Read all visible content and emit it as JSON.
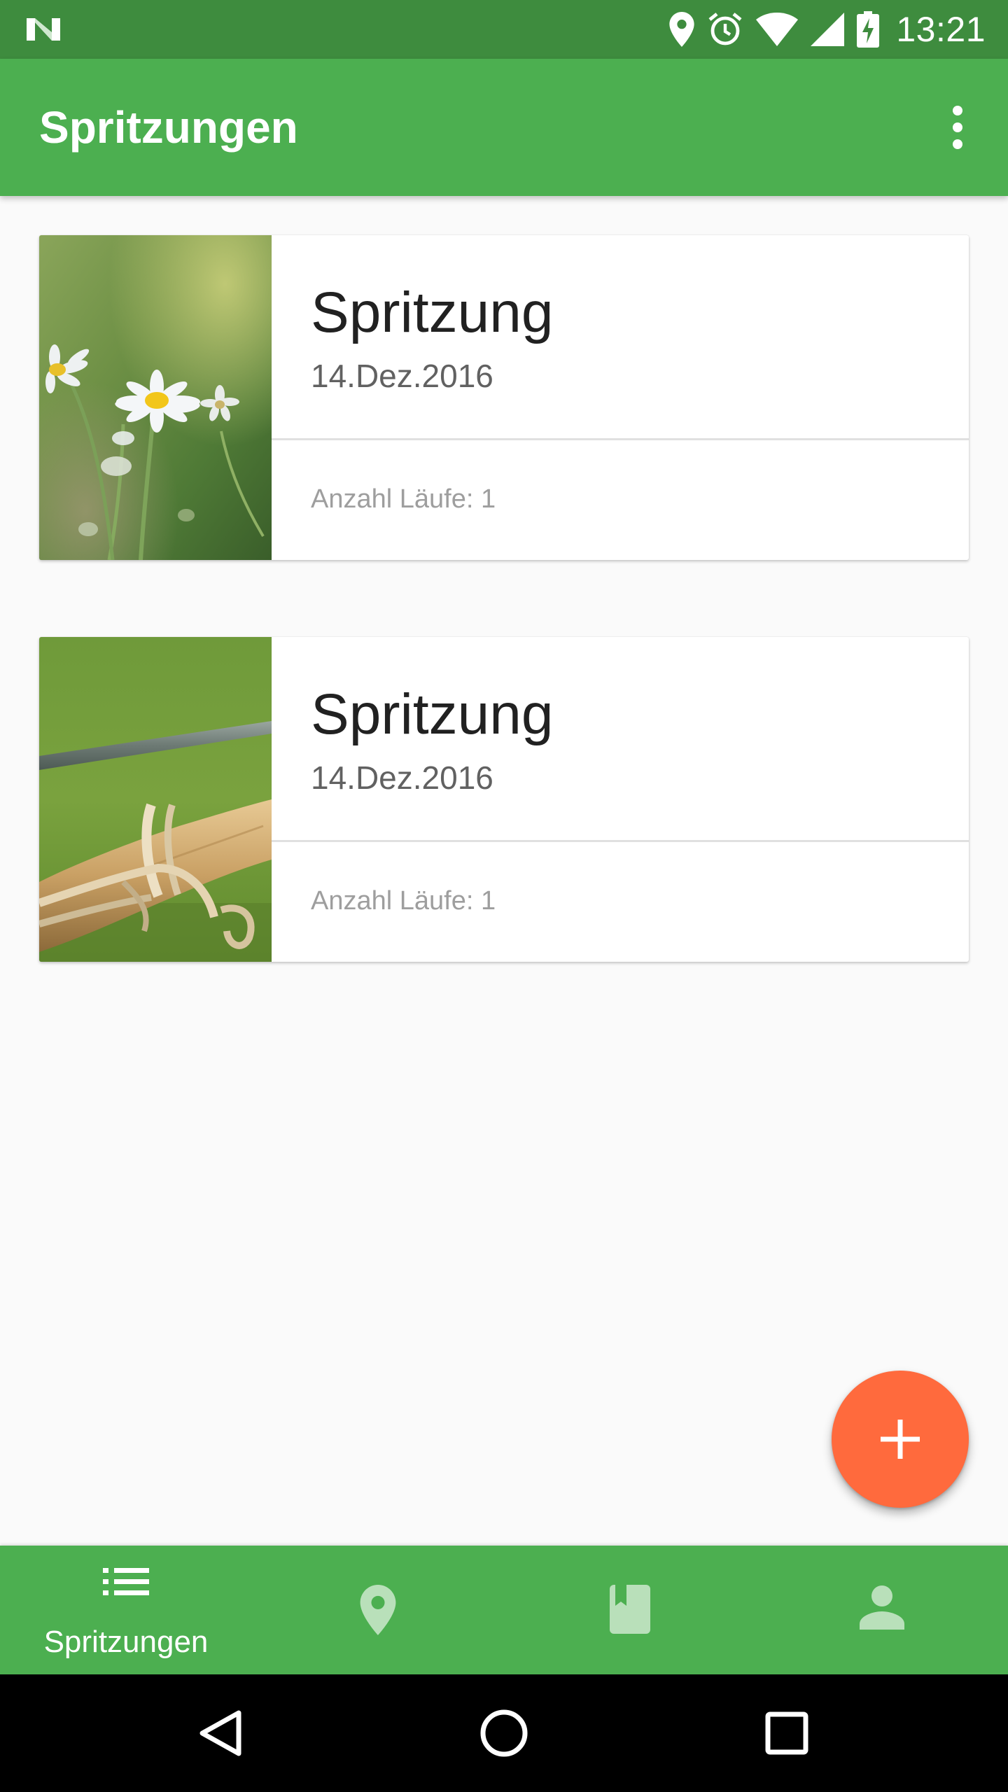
{
  "status_bar": {
    "time": "13:21",
    "icons": [
      "notification-n-icon",
      "location-icon",
      "alarm-icon",
      "wifi-icon",
      "signal-icon",
      "battery-charging-icon"
    ]
  },
  "app_bar": {
    "title": "Spritzungen",
    "menu_icon": "more-vert-icon"
  },
  "cards": [
    {
      "title": "Spritzung",
      "date": "14.Dez.2016",
      "runs": "Anzahl Läufe: 1",
      "image": "daisy-flowers"
    },
    {
      "title": "Spritzung",
      "date": "14.Dez.2016",
      "runs": "Anzahl Läufe: 1",
      "image": "vine-wire"
    }
  ],
  "fab": {
    "icon": "add-icon"
  },
  "bottom_nav": {
    "items": [
      {
        "icon": "list-icon",
        "label": "Spritzungen",
        "active": true
      },
      {
        "icon": "location-pin-icon",
        "label": "",
        "active": false
      },
      {
        "icon": "book-icon",
        "label": "",
        "active": false
      },
      {
        "icon": "person-icon",
        "label": "",
        "active": false
      }
    ]
  },
  "system_nav": {
    "icons": [
      "back-icon",
      "home-icon",
      "recents-icon"
    ]
  },
  "colors": {
    "status_bar": "#3e8c3e",
    "primary": "#4caf50",
    "accent": "#ff6a3d",
    "background": "#fafafa"
  }
}
